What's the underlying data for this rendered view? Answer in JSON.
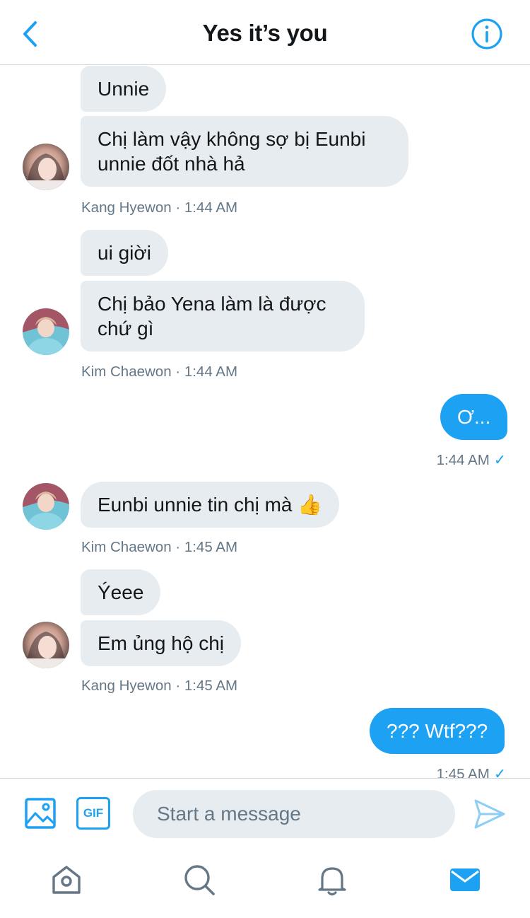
{
  "header": {
    "title": "Yes it’s you",
    "back_icon": "chevron-left-icon",
    "info_icon": "info-icon"
  },
  "messages": [
    {
      "sender": "Kang Hyewon",
      "text": "Unnie",
      "mine": false
    },
    {
      "sender": "Kang Hyewon",
      "text": "Chị làm vậy không sợ bị Eunbi unnie đốt nhà hả",
      "mine": false
    },
    {
      "meta": "Kang Hyewon · 1:44 AM"
    },
    {
      "sender": "Kim Chaewon",
      "text": "ui giời",
      "mine": false
    },
    {
      "sender": "Kim Chaewon",
      "text": "Chị bảo Yena làm là được chứ gì",
      "mine": false
    },
    {
      "meta": "Kim Chaewon · 1:44 AM"
    },
    {
      "text": "Ơ...",
      "mine": true
    },
    {
      "meta": "1:44 AM",
      "check": "✓"
    },
    {
      "sender": "Kim Chaewon",
      "text": "Eunbi unnie tin chị mà 👍",
      "mine": false
    },
    {
      "meta": "Kim Chaewon · 1:45 AM"
    },
    {
      "sender": "Kang Hyewon",
      "text": "Ýeee",
      "mine": false
    },
    {
      "sender": "Kang Hyewon",
      "text": "Em ủng hộ chị",
      "mine": false
    },
    {
      "meta": "Kang Hyewon · 1:45 AM"
    },
    {
      "text": "??? Wtf???",
      "mine": true
    },
    {
      "meta": "1:45 AM",
      "check": "✓"
    }
  ],
  "composer": {
    "placeholder": "Start a message",
    "gif_label": "GIF",
    "image_icon": "image-icon",
    "send_icon": "send-icon"
  },
  "tabbar": {
    "items": [
      "home-icon",
      "search-icon",
      "bell-icon",
      "mail-icon"
    ],
    "active": "mail-icon"
  },
  "colors": {
    "accent": "#1da1f2",
    "bubble_other": "#e6ecf0",
    "meta_text": "#657786",
    "divider": "#d4d8dc"
  }
}
